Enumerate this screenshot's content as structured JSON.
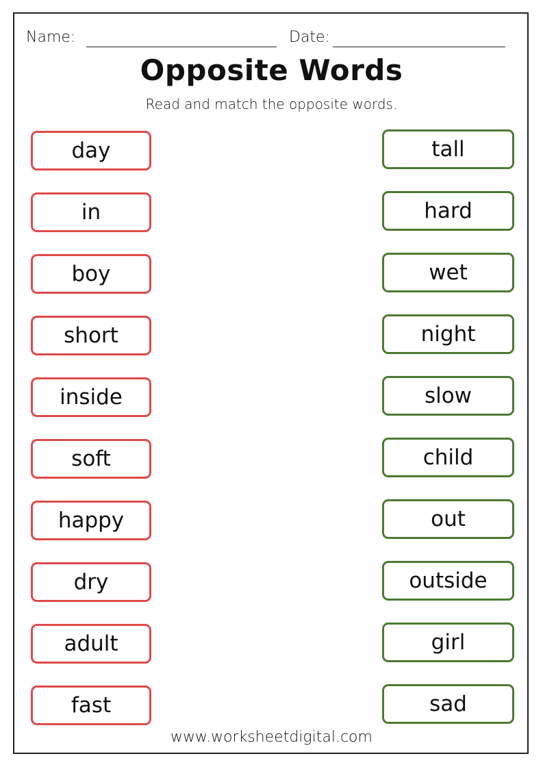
{
  "header": {
    "name_label": "Name:",
    "date_label": "Date:"
  },
  "title": "Opposite Words",
  "subtitle": "Read and match the opposite words.",
  "colors": {
    "left_border": "#e04a4a",
    "right_border": "#4b7a34"
  },
  "left_words": [
    "day",
    "in",
    "boy",
    "short",
    "inside",
    "soft",
    "happy",
    "dry",
    "adult",
    "fast"
  ],
  "right_words": [
    "tall",
    "hard",
    "wet",
    "night",
    "slow",
    "child",
    "out",
    "outside",
    "girl",
    "sad"
  ],
  "footer": "www.worksheetdigital.com"
}
